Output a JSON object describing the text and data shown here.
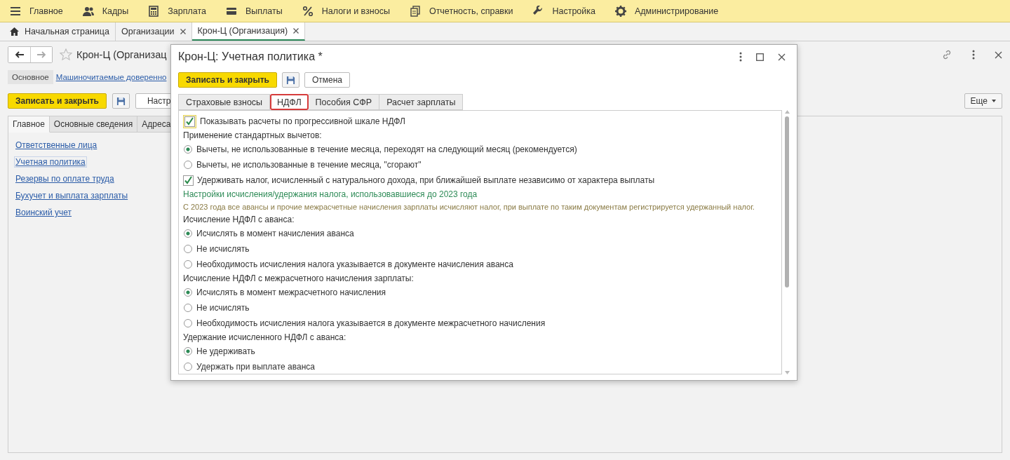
{
  "menu": [
    {
      "label": "Главное"
    },
    {
      "label": "Кадры"
    },
    {
      "label": "Зарплата"
    },
    {
      "label": "Выплаты"
    },
    {
      "label": "Налоги и взносы"
    },
    {
      "label": "Отчетность, справки"
    },
    {
      "label": "Настройка"
    },
    {
      "label": "Администрирование"
    }
  ],
  "open_tabs": [
    {
      "kind": "home",
      "label": "Начальная страница",
      "selected": false
    },
    {
      "kind": "page",
      "label": "Организации",
      "selected": false
    },
    {
      "kind": "page",
      "label": "Крон-Ц (Организация)",
      "selected": true
    }
  ],
  "form": {
    "title": "Крон-Ц (Организац",
    "sections": [
      {
        "label": "Основное",
        "selected": true
      },
      {
        "label": "Машиночитаемые доверенно",
        "selected": false
      }
    ],
    "toolbar": {
      "save_close": "Записать и закрыть",
      "settings": "Настр",
      "more": "Еще"
    },
    "tabs": [
      {
        "label": "Главное",
        "selected": true
      },
      {
        "label": "Основные сведения",
        "selected": false
      },
      {
        "label": "Адреса",
        "selected": false
      }
    ],
    "links": [
      {
        "label": "Ответственные лица",
        "focused": false
      },
      {
        "label": "Учетная политика",
        "focused": true
      },
      {
        "label": "Резервы по оплате труда",
        "focused": false
      },
      {
        "label": "Бухучет и выплата зарплаты",
        "focused": false
      },
      {
        "label": "Воинский учет",
        "focused": false
      }
    ]
  },
  "dialog": {
    "title": "Крон-Ц: Учетная политика *",
    "buttons": [
      {
        "kind": "primary",
        "label": "Записать и закрыть"
      },
      {
        "kind": "save"
      },
      {
        "kind": "plain",
        "label": "Отмена"
      }
    ],
    "tabs": [
      {
        "label": "Страховые взносы",
        "selected": false,
        "highlighted": false
      },
      {
        "label": "НДФЛ",
        "selected": true,
        "highlighted": true
      },
      {
        "label": "Пособия СФР",
        "selected": false,
        "highlighted": false
      },
      {
        "label": "Расчет зарплаты",
        "selected": false,
        "highlighted": false
      }
    ],
    "settings": [
      {
        "kind": "checkbox",
        "label": "Показывать расчеты по прогрессивной шкале НДФЛ",
        "checked": true,
        "focused": true
      },
      {
        "kind": "label",
        "label": "Применение стандартных вычетов:"
      },
      {
        "kind": "radio",
        "label": "Вычеты, не использованные в течение месяца, переходят на следующий месяц (рекомендуется)",
        "selected": true
      },
      {
        "kind": "radio",
        "label": "Вычеты, не использованные в течение месяца, \"сгорают\"",
        "selected": false
      },
      {
        "kind": "checkbox",
        "label": "Удерживать налог, исчисленный с натурального дохода, при ближайшей выплате независимо от характера выплаты",
        "checked": true,
        "focused": false
      },
      {
        "kind": "heading",
        "label": "Настройки исчисления/удержания налога, использовавшиеся до 2023 года"
      },
      {
        "kind": "note",
        "label": "С 2023 года все авансы и прочие межрасчетные начисления зарплаты исчисляют налог, при выплате по таким документам регистрируется удержанный налог."
      },
      {
        "kind": "label",
        "label": "Исчисление НДФЛ с аванса:"
      },
      {
        "kind": "radio",
        "label": "Исчислять в момент начисления аванса",
        "selected": true
      },
      {
        "kind": "radio",
        "label": "Не исчислять",
        "selected": false
      },
      {
        "kind": "radio",
        "label": "Необходимость исчисления налога указывается в документе начисления аванса",
        "selected": false
      },
      {
        "kind": "label",
        "label": "Исчисление НДФЛ с межрасчетного начисления зарплаты:"
      },
      {
        "kind": "radio",
        "label": "Исчислять в момент межрасчетного начисления",
        "selected": true
      },
      {
        "kind": "radio",
        "label": "Не исчислять",
        "selected": false
      },
      {
        "kind": "radio",
        "label": "Необходимость исчисления налога указывается в документе межрасчетного начисления",
        "selected": false
      },
      {
        "kind": "label",
        "label": "Удержание исчисленного НДФЛ с аванса:"
      },
      {
        "kind": "radio",
        "label": "Не удерживать",
        "selected": true
      },
      {
        "kind": "radio",
        "label": "Удержать при выплате аванса",
        "selected": false
      }
    ]
  }
}
